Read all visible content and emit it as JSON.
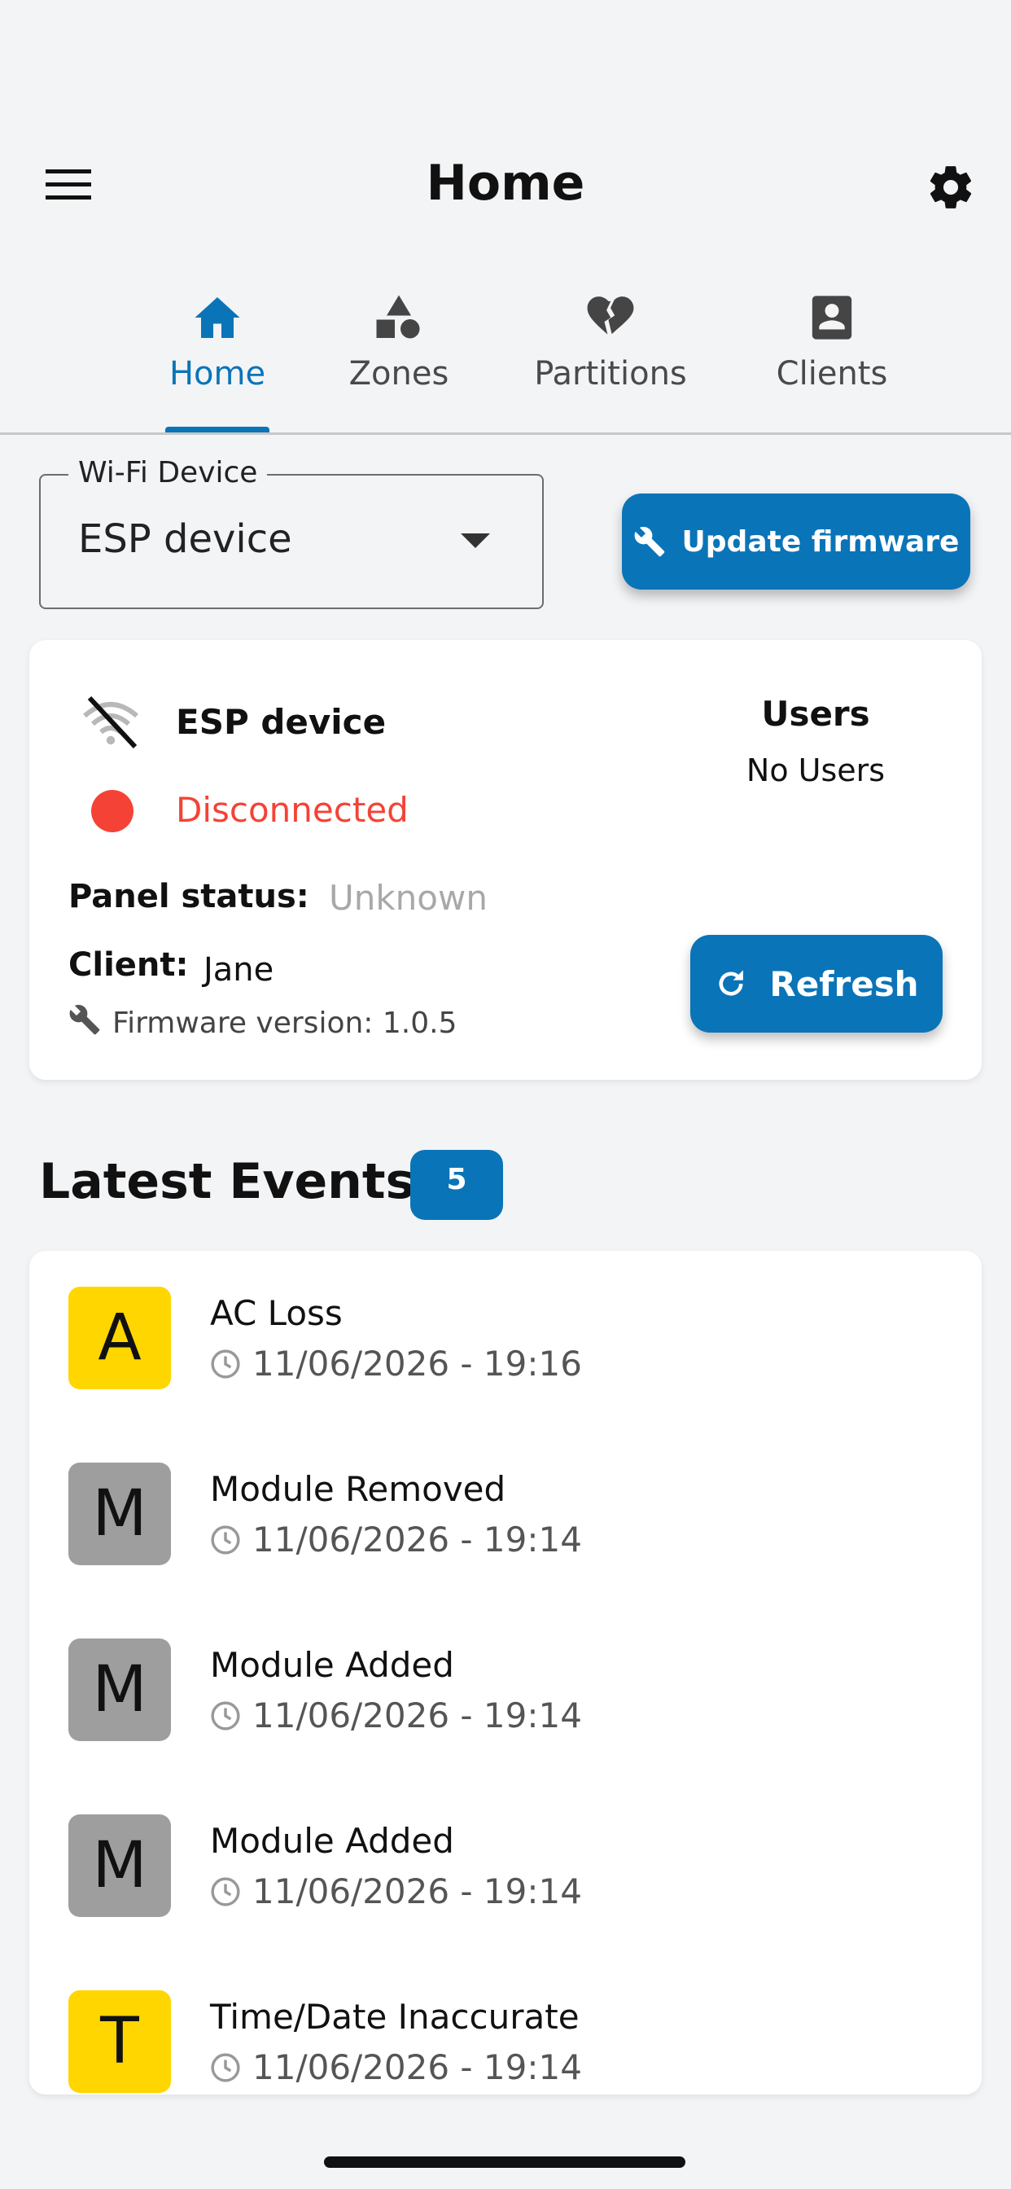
{
  "header": {
    "title": "Home"
  },
  "tabs": [
    {
      "label": "Home",
      "icon": "home-icon",
      "active": true
    },
    {
      "label": "Zones",
      "icon": "shapes-icon",
      "active": false
    },
    {
      "label": "Partitions",
      "icon": "broken-heart-icon",
      "active": false
    },
    {
      "label": "Clients",
      "icon": "contact-card-icon",
      "active": false
    }
  ],
  "wifi": {
    "legend": "Wi-Fi Device",
    "selected": "ESP device"
  },
  "update_button": {
    "label": "Update firmware"
  },
  "device": {
    "name": "ESP device",
    "status": "Disconnected",
    "users_heading": "Users",
    "users_value": "No Users",
    "panel_status_label": "Panel status:",
    "panel_status_value": "Unknown",
    "client_label": "Client:",
    "client_value": "Jane",
    "firmware": "Firmware version: 1.0.5",
    "refresh_label": "Refresh"
  },
  "events": {
    "title": "Latest Events",
    "count": "5",
    "items": [
      {
        "letter": "A",
        "title": "AC Loss",
        "time": "11/06/2026 - 19:16",
        "color": "#FFD600"
      },
      {
        "letter": "M",
        "title": "Module Removed",
        "time": "11/06/2026 - 19:14",
        "color": "#9E9E9E"
      },
      {
        "letter": "M",
        "title": "Module Added",
        "time": "11/06/2026 - 19:14",
        "color": "#9E9E9E"
      },
      {
        "letter": "M",
        "title": "Module Added",
        "time": "11/06/2026 - 19:14",
        "color": "#9E9E9E"
      },
      {
        "letter": "T",
        "title": "Time/Date Inaccurate",
        "time": "11/06/2026 - 19:14",
        "color": "#FFD600"
      }
    ]
  },
  "colors": {
    "accent": "#0a74b8",
    "error": "#f44336",
    "background": "#f3f4f6"
  }
}
